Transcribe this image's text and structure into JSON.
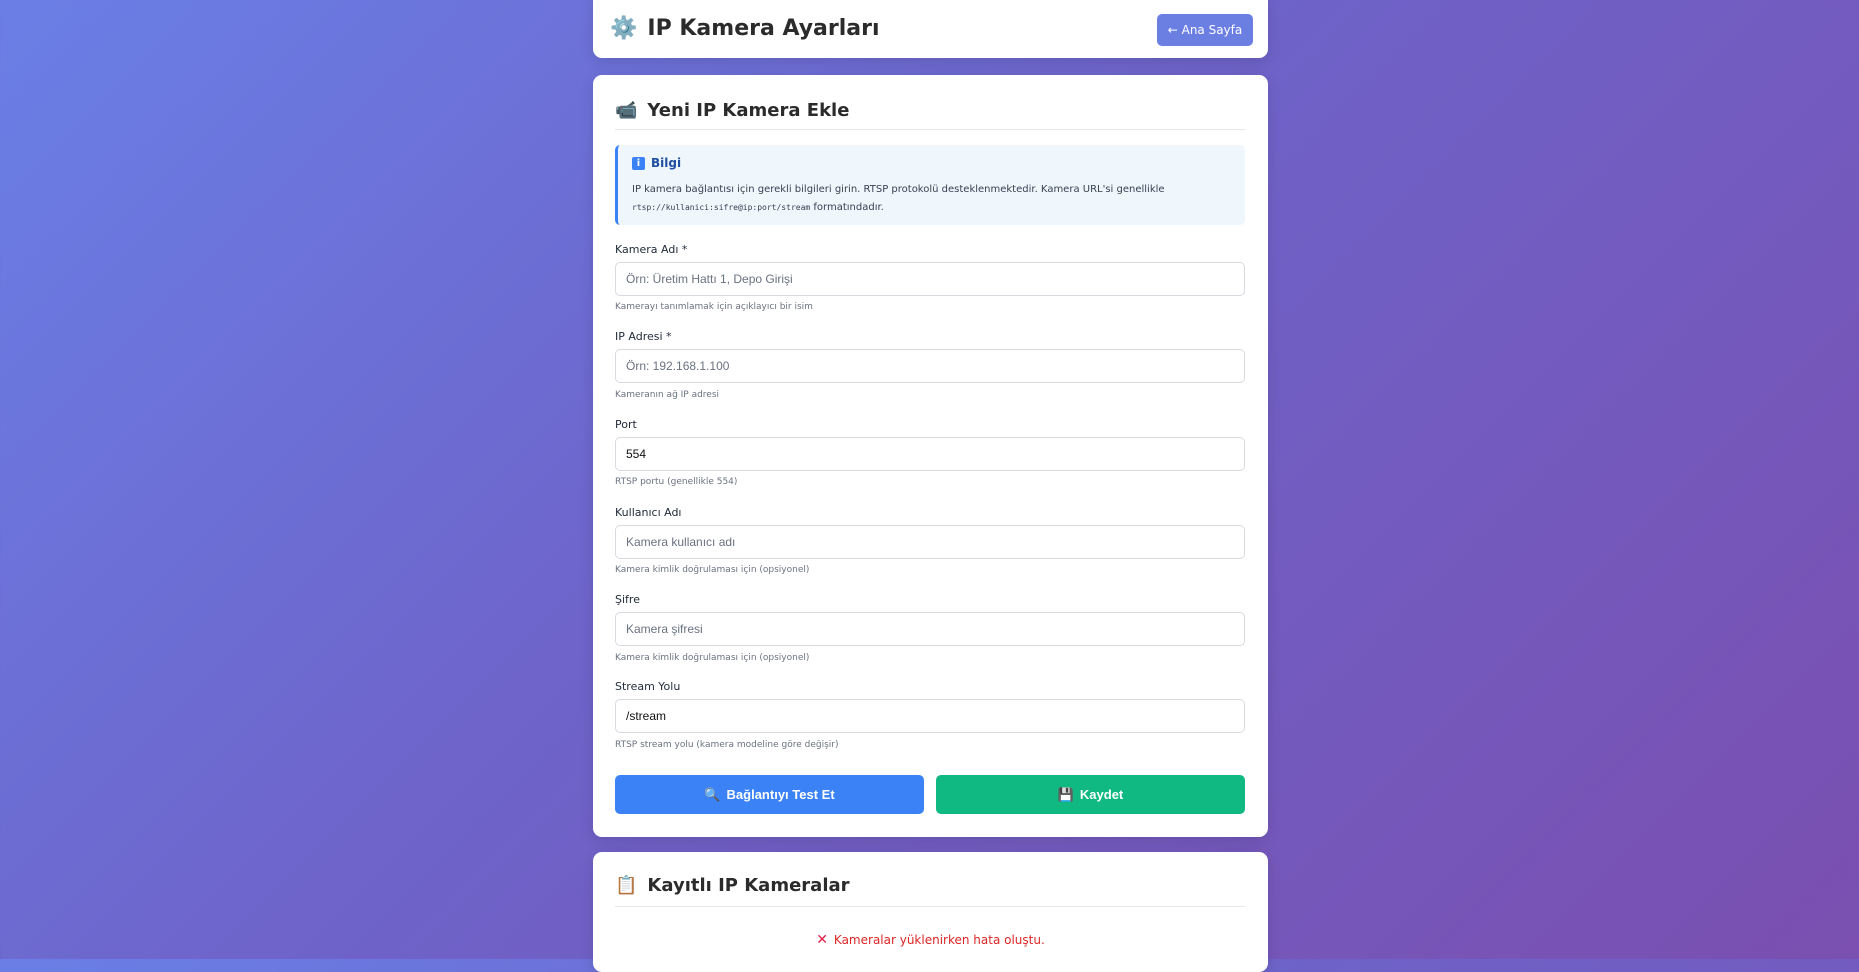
{
  "header": {
    "icon": "gear-icon",
    "icon_glyph": "⚙️",
    "title": "IP Kamera Ayarları",
    "back_label": "← Ana Sayfa"
  },
  "form": {
    "icon": "camera-icon",
    "icon_glyph": "📹",
    "title": "Yeni IP Kamera Ekle",
    "info": {
      "icon": "info-icon",
      "icon_glyph": "i",
      "title": "Bilgi",
      "text_before": "IP kamera bağlantısı için gerekli bilgileri girin. RTSP protokolü desteklenmektedir. Kamera URL'si genellikle",
      "code": "rtsp://kullanici:sifre@ip:port/stream",
      "text_after": "formatındadır."
    },
    "fields": {
      "name": {
        "label": "Kamera Adı *",
        "placeholder": "Örn: Üretim Hattı 1, Depo Girişi",
        "value": "",
        "hint": "Kamerayı tanımlamak için açıklayıcı bir isim"
      },
      "ip": {
        "label": "IP Adresi *",
        "placeholder": "Örn: 192.168.1.100",
        "value": "",
        "hint": "Kameranın ağ IP adresi"
      },
      "port": {
        "label": "Port",
        "placeholder": "",
        "value": "554",
        "hint": "RTSP portu (genellikle 554)"
      },
      "username": {
        "label": "Kullanıcı Adı",
        "placeholder": "Kamera kullanıcı adı",
        "value": "",
        "hint": "Kamera kimlik doğrulaması için (opsiyonel)"
      },
      "password": {
        "label": "Şifre",
        "placeholder": "Kamera şifresi",
        "value": "",
        "hint": "Kamera kimlik doğrulaması için (opsiyonel)"
      },
      "stream": {
        "label": "Stream Yolu",
        "placeholder": "",
        "value": "/stream",
        "hint": "RTSP stream yolu (kamera modeline göre değişir)"
      }
    },
    "buttons": {
      "test_icon": "magnifier-icon",
      "test_glyph": "🔍",
      "test_label": "Bağlantıyı Test Et",
      "save_icon": "floppy-disk-icon",
      "save_glyph": "💾",
      "save_label": "Kaydet"
    }
  },
  "list": {
    "icon": "clipboard-icon",
    "icon_glyph": "📋",
    "title": "Kayıtlı IP Kameralar",
    "error_icon": "x-icon",
    "error_glyph": "✕",
    "error_text": "Kameralar yüklenirken hata oluştu."
  },
  "colors": {
    "accent": "#6b7fe3",
    "test_button": "#3b82f6",
    "save_button": "#10b981",
    "error": "#dc2626"
  }
}
